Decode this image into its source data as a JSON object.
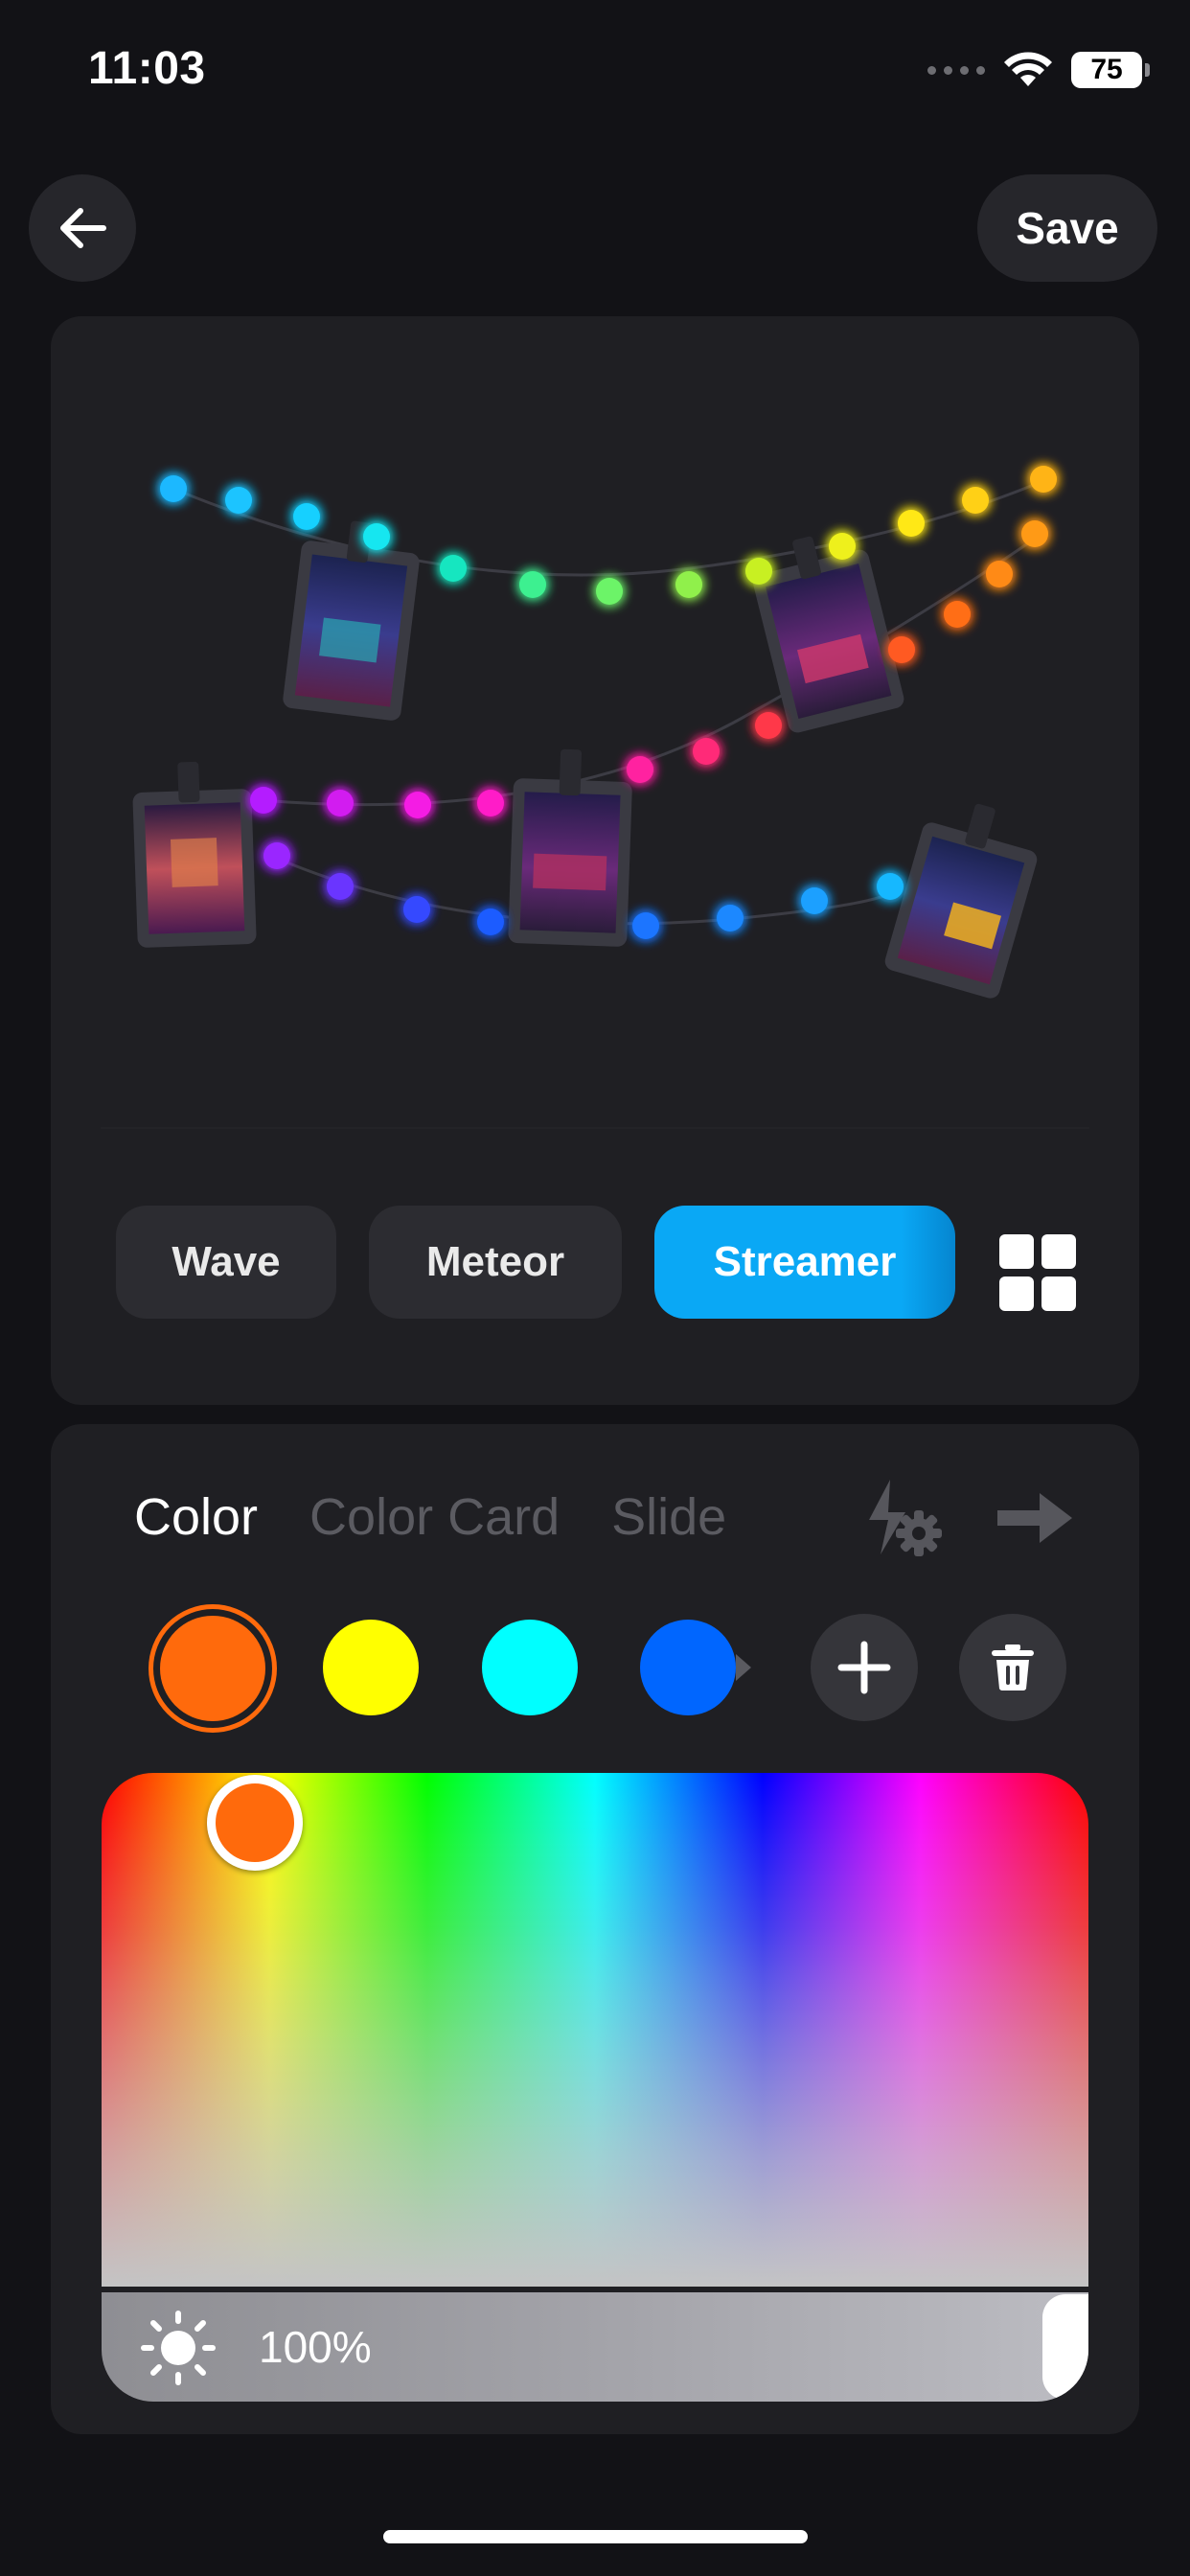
{
  "status_bar": {
    "time": "11:03",
    "battery": "75"
  },
  "header": {
    "save_label": "Save",
    "back_icon": "arrow-left-icon"
  },
  "effects": {
    "items": [
      {
        "label": "Wave",
        "active": false
      },
      {
        "label": "Meteor",
        "active": false
      },
      {
        "label": "Streamer",
        "active": true
      }
    ],
    "grid_icon": "grid-icon",
    "accent": "#0AA8F5"
  },
  "color_panel": {
    "tabs": [
      {
        "label": "Color",
        "active": true
      },
      {
        "label": "Color Card",
        "active": false
      },
      {
        "label": "Slide",
        "active": false
      }
    ],
    "tool_icons": [
      "lightning-settings-icon",
      "arrow-right-icon"
    ],
    "swatches": [
      "#FF6A0C",
      "#FFFF00",
      "#00FFFF",
      "#0066FF"
    ],
    "selected_swatch": "#FF6A0C",
    "add_icon": "plus-icon",
    "delete_icon": "trash-icon",
    "brightness": {
      "value": "100%",
      "level": 1.0,
      "icon": "sun-icon"
    }
  }
}
